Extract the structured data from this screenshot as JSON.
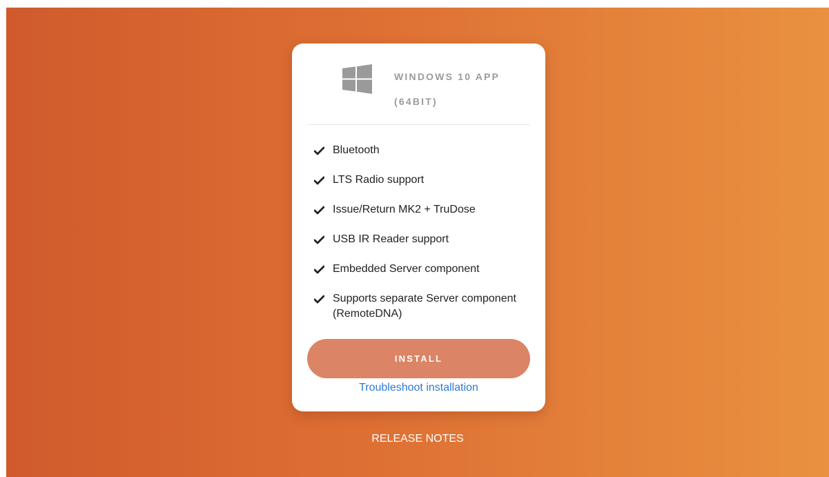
{
  "colors": {
    "gradient_start": "#d05a2c",
    "gradient_end": "#e99140",
    "card_background": "#ffffff",
    "title_text": "#9b9b9b",
    "install_button": "#db8466",
    "link": "#2a7ad4"
  },
  "card": {
    "icon": "windows-logo-icon",
    "title": "WINDOWS 10 APP (64BIT)",
    "features": [
      "Bluetooth",
      "LTS Radio support",
      "Issue/Return MK2 + TruDose",
      "USB IR Reader support",
      "Embedded Server component",
      "Supports separate Server component (RemoteDNA)"
    ],
    "feature_icon": "checkmark-icon",
    "install_label": "INSTALL",
    "troubleshoot_label": "Troubleshoot installation"
  },
  "footer": {
    "release_notes_label": "RELEASE NOTES"
  }
}
